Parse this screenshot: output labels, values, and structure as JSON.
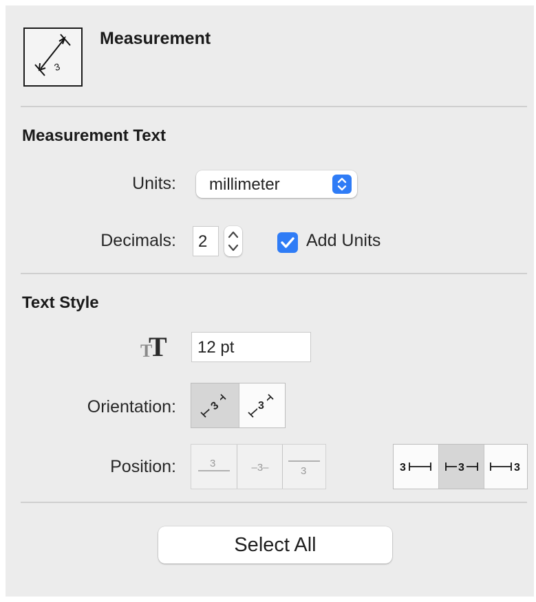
{
  "header": {
    "tool_icon": "measurement-tool-icon",
    "title": "Measurement"
  },
  "measurement_text": {
    "section_title": "Measurement Text",
    "units_label": "Units:",
    "units_value": "millimeter",
    "decimals_label": "Decimals:",
    "decimals_value": "2",
    "add_units_label": "Add Units",
    "add_units_checked": true
  },
  "text_style": {
    "section_title": "Text Style",
    "font_size_icon": "text-size-icon",
    "font_size_value": "12 pt",
    "orientation_label": "Orientation:",
    "orientation_options": [
      {
        "icon": "orientation-aligned-icon",
        "label": "3",
        "selected": true
      },
      {
        "icon": "orientation-horizontal-icon",
        "label": "3",
        "selected": false
      }
    ],
    "position_label": "Position:",
    "vertical_position_options": [
      {
        "icon": "text-above-line-icon",
        "label": "3",
        "enabled": false
      },
      {
        "icon": "text-on-line-icon",
        "label": "–3–",
        "enabled": false
      },
      {
        "icon": "text-below-line-icon",
        "label": "3",
        "enabled": false
      }
    ],
    "horizontal_position_options": [
      {
        "icon": "text-left-icon",
        "label": "3",
        "selected": false
      },
      {
        "icon": "text-center-icon",
        "label": "3",
        "selected": true
      },
      {
        "icon": "text-right-icon",
        "label": "3",
        "selected": false
      }
    ]
  },
  "actions": {
    "select_all_label": "Select All"
  },
  "colors": {
    "accent": "#2f7cf6",
    "panel_background": "#ececec",
    "separator": "#cfcfcf"
  }
}
